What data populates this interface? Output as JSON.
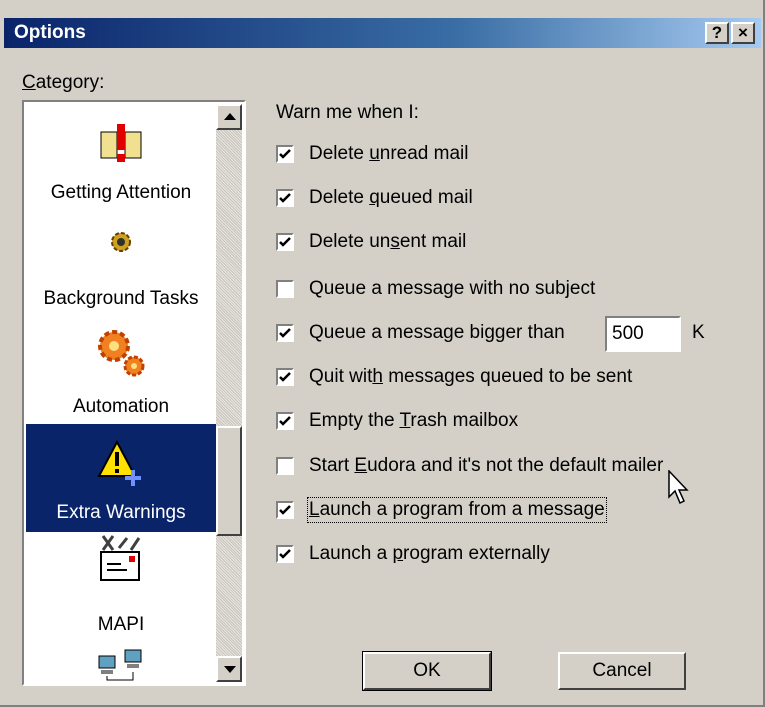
{
  "window": {
    "title": "Options",
    "help_button": "?",
    "close_button": "×"
  },
  "category": {
    "label_prefix": "C",
    "label_rest": "ategory:",
    "items": [
      {
        "label": "Getting Attention",
        "icon": "attention-icon"
      },
      {
        "label": "Background Tasks",
        "icon": "background-tasks-icon"
      },
      {
        "label": "Automation",
        "icon": "automation-gears-icon"
      },
      {
        "label": "Extra Warnings",
        "icon": "warning-icon",
        "selected": true
      },
      {
        "label": "MAPI",
        "icon": "mapi-icon"
      },
      {
        "label": "",
        "icon": "network-computers-icon"
      }
    ]
  },
  "warnings": {
    "heading": "Warn me when I:",
    "options": [
      {
        "pre": "Delete ",
        "u": "u",
        "post": "nread mail",
        "checked": true
      },
      {
        "pre": "Delete ",
        "u": "q",
        "post": "ueued mail",
        "checked": true
      },
      {
        "pre": "Delete un",
        "u": "s",
        "post": "ent mail",
        "checked": true
      },
      {
        "pre": "Queue a message with no sub",
        "u": "j",
        "post": "ect",
        "checked": false
      },
      {
        "pre": "Queue a message bi",
        "u": "g",
        "post": "ger than",
        "checked": true
      },
      {
        "pre": "Quit wit",
        "u": "h",
        "post": " messages queued to be sent",
        "checked": true
      },
      {
        "pre": "Empty the ",
        "u": "T",
        "post": "rash mailbox",
        "checked": true
      },
      {
        "pre": "Start ",
        "u": "E",
        "post": "udora and it's not the default mailer",
        "checked": false
      },
      {
        "pre": "",
        "u": "L",
        "post": "aunch a program from a message",
        "checked": true
      },
      {
        "pre": "Launch a ",
        "u": "p",
        "post": "rogram externally",
        "checked": true
      }
    ],
    "size_value": "500",
    "size_unit": "K"
  },
  "buttons": {
    "ok": "OK",
    "cancel": "Cancel"
  }
}
